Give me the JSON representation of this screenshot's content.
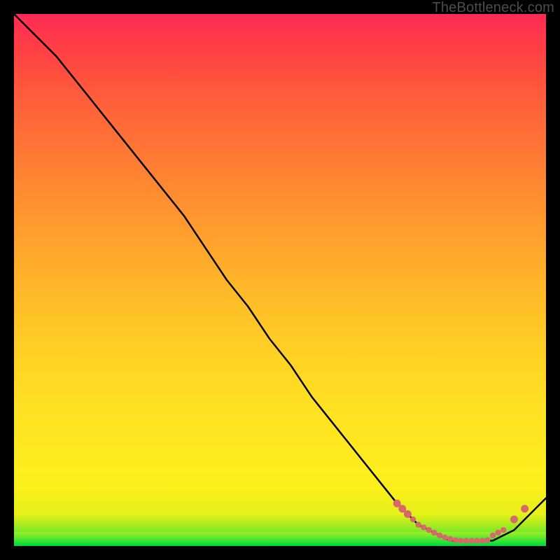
{
  "watermark": "TheBottleneck.com",
  "colors": {
    "curve_stroke": "#000000",
    "marker_fill": "#d66a6a",
    "bg": "#000000"
  },
  "chart_data": {
    "type": "line",
    "title": "",
    "xlabel": "",
    "ylabel": "",
    "xlim": [
      0,
      100
    ],
    "ylim": [
      0,
      100
    ],
    "background": "vertical-gradient green→yellow→orange→red (bottom→top)",
    "series": [
      {
        "name": "bottleneck-curve",
        "x": [
          0,
          4,
          8,
          12,
          16,
          20,
          24,
          28,
          32,
          36,
          40,
          44,
          48,
          52,
          56,
          60,
          64,
          68,
          72,
          74,
          76,
          78,
          80,
          82,
          84,
          86,
          88,
          90,
          92,
          94,
          96,
          98,
          100
        ],
        "y": [
          100,
          96,
          92,
          87,
          82,
          77,
          72,
          67,
          62,
          56,
          50,
          45,
          39,
          34,
          28,
          23,
          18,
          13,
          8,
          6,
          4,
          3,
          2,
          1,
          1,
          1,
          1,
          1,
          2,
          3,
          5,
          7,
          9
        ]
      }
    ],
    "markers": {
      "name": "fit-region",
      "x": [
        72,
        73,
        74,
        75,
        76,
        77,
        78,
        79,
        80,
        81,
        82,
        83,
        84,
        85,
        86,
        87,
        88,
        89,
        90,
        91,
        92,
        94,
        96
      ],
      "y": [
        8,
        7,
        6,
        5,
        4,
        3.5,
        3,
        2.5,
        2,
        1.6,
        1.3,
        1.1,
        1,
        1,
        1,
        1,
        1,
        1.1,
        2,
        2.5,
        3,
        5,
        7
      ]
    }
  }
}
